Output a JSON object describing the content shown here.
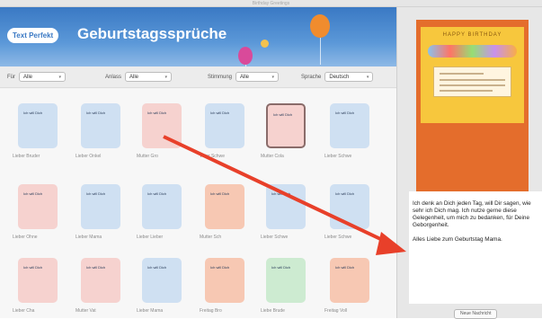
{
  "window": {
    "title": "Birthday Greetings"
  },
  "banner": {
    "brand": "Text Perfekt",
    "title": "Geburtstagssprüche"
  },
  "filters": [
    {
      "label": "Für",
      "value": "Alle"
    },
    {
      "label": "Anlass",
      "value": "Alle"
    },
    {
      "label": "Stimmung",
      "value": "Alle"
    },
    {
      "label": "Sprache",
      "value": "Deutsch"
    }
  ],
  "cards": [
    {
      "text": "Ich will Dich",
      "caption": "Lieber Bruder",
      "color": "blue"
    },
    {
      "text": "Ich will Dich",
      "caption": "Lieber Onkel",
      "color": "blue"
    },
    {
      "text": "Ich will Dich",
      "caption": "Mutter Gro",
      "color": "pink"
    },
    {
      "text": "Ich will Dich",
      "caption": "Vater Schwe",
      "color": "blue"
    },
    {
      "text": "Ich will Dich",
      "caption": "Mutter Cola",
      "color": "pink"
    },
    {
      "text": "Ich will Dich",
      "caption": "Lieber Schwe",
      "color": "blue"
    },
    {
      "text": "Ich will Dich",
      "caption": "Lieber Ohne",
      "color": "pink"
    },
    {
      "text": "Ich will Dich",
      "caption": "Lieber Mama",
      "color": "blue"
    },
    {
      "text": "Ich will Dich",
      "caption": "Lieber Lieber",
      "color": "blue"
    },
    {
      "text": "Ich will Dich",
      "caption": "Mutter Sch",
      "color": "orange"
    },
    {
      "text": "Ich will Dich",
      "caption": "Lieber Schwe",
      "color": "blue"
    },
    {
      "text": "Ich will Dich",
      "caption": "Lieber Schwe",
      "color": "blue"
    },
    {
      "text": "Ich will Dich",
      "caption": "Lieber Cha",
      "color": "pink"
    },
    {
      "text": "Ich will Dich",
      "caption": "Mutter Vat",
      "color": "pink"
    },
    {
      "text": "Ich will Dich",
      "caption": "Lieber Mama",
      "color": "blue"
    },
    {
      "text": "Ich will Dich",
      "caption": "Freitag Bro",
      "color": "orange"
    },
    {
      "text": "Ich will Dich",
      "caption": "Liebe Brude",
      "color": "green"
    },
    {
      "text": "Ich will Dich",
      "caption": "Freitag Voll",
      "color": "orange"
    }
  ],
  "preview": {
    "header": "HAPPY BIRTHDAY"
  },
  "message": {
    "paragraph1": "Ich denk an Dich jeden Tag, will Dir sagen, wie sehr ich Dich mag. Ich nutze gerne diese Gelegenheit, um mich zu bedanken, für Deine Geborgenheit.",
    "paragraph2": "Alles Liebe zum Geburtstag Mama."
  },
  "footer": {
    "button": "Neue Nachricht"
  },
  "colors": {
    "accent": "#3a79c4",
    "arrow": "#e8402a"
  }
}
